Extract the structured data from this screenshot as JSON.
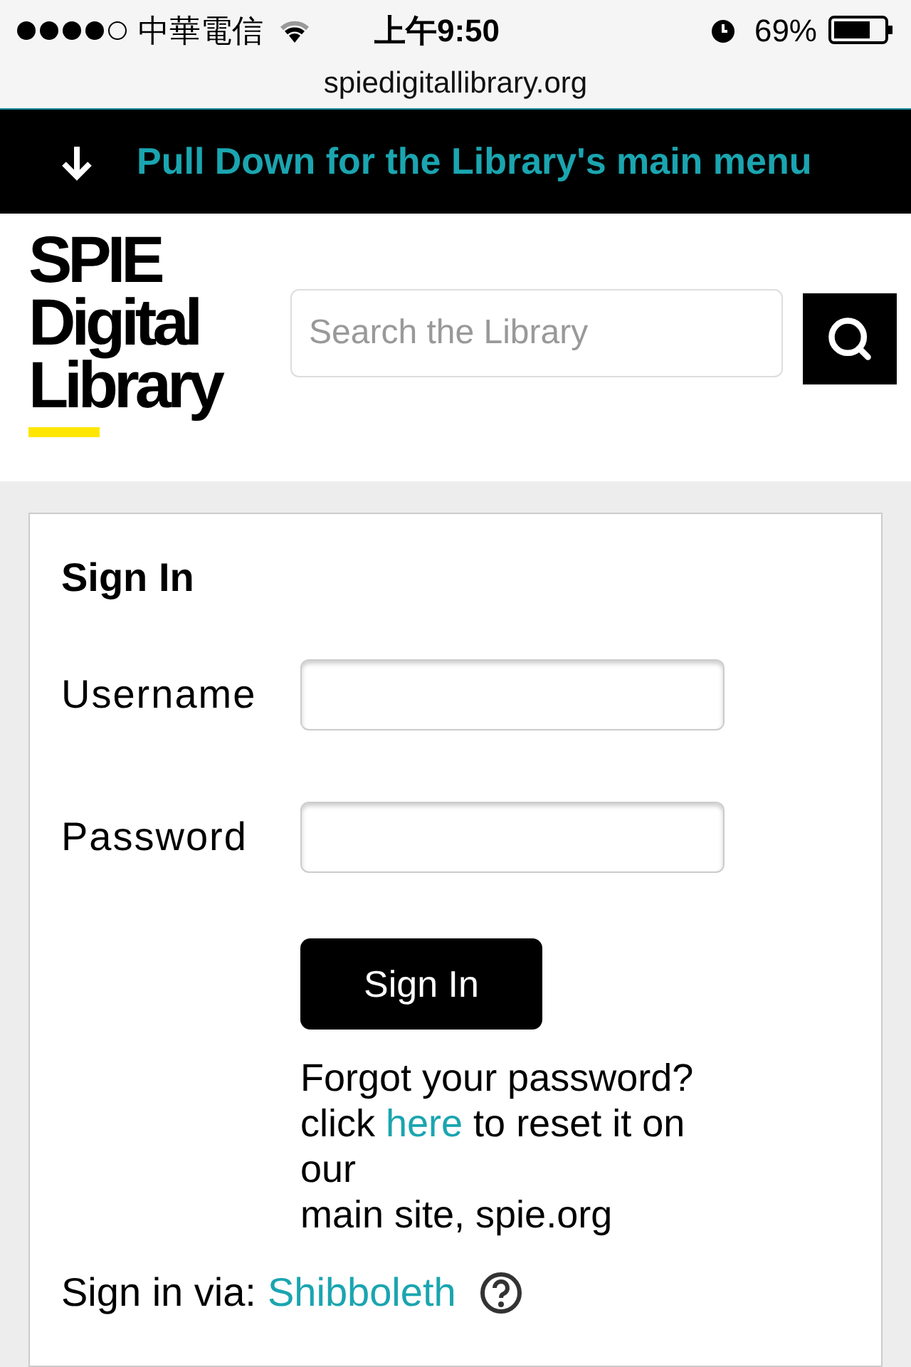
{
  "status_bar": {
    "carrier": "中華電信",
    "time": "上午9:50",
    "battery": "69%"
  },
  "address_bar": {
    "url": "spiedigitallibrary.org"
  },
  "banner": {
    "text": "Pull Down for the Library's main menu"
  },
  "logo": {
    "lines": [
      "SPIE",
      "Digital",
      "Library"
    ]
  },
  "search": {
    "placeholder": "Search the Library"
  },
  "sign_in": {
    "title": "Sign In",
    "fields": [
      {
        "label": "Username"
      },
      {
        "label": "Password"
      }
    ],
    "button": "Sign In",
    "forgot": {
      "line_1": "Forgot your password?",
      "before": "click ",
      "link": "here",
      "after": " to reset it on our",
      "line_3": "main site, spie.org"
    },
    "via": {
      "label": "Sign in via:",
      "link": "Shibboleth"
    }
  }
}
